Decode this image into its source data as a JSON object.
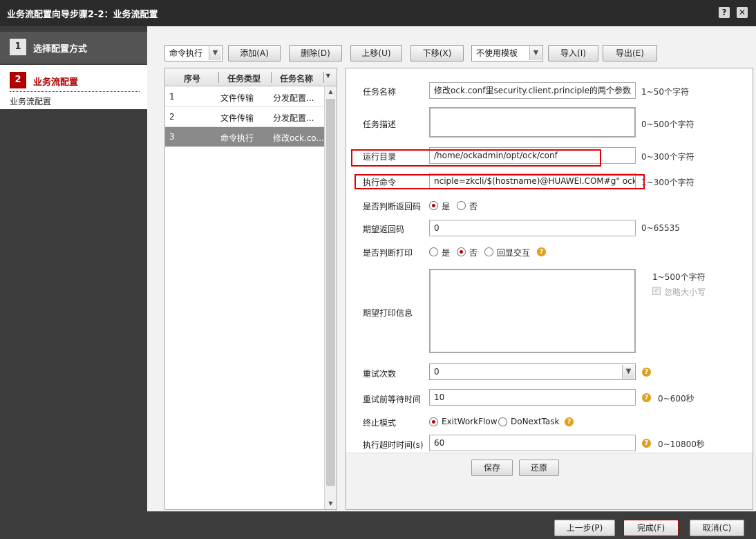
{
  "window": {
    "title": "业务流配置向导步骤2-2：业务流配置",
    "help_label": "?",
    "close_label": "✕"
  },
  "nav": {
    "step1": {
      "num": "1",
      "label": "选择配置方式"
    },
    "step2": {
      "num": "2",
      "label": "业务流配置",
      "sub": "业务流配置"
    }
  },
  "toolbar": {
    "type_select": "命令执行",
    "add": "添加(A)",
    "delete": "删除(D)",
    "move_up": "上移(U)",
    "move_down": "下移(X)",
    "template_select": "不使用模板",
    "import": "导入(I)",
    "export": "导出(E)"
  },
  "tasklist": {
    "headers": [
      "序号",
      "任务类型",
      "任务名称"
    ],
    "rows": [
      {
        "no": "1",
        "type": "文件传输",
        "name": "分发配置..."
      },
      {
        "no": "2",
        "type": "文件传输",
        "name": "分发配置..."
      },
      {
        "no": "3",
        "type": "命令执行",
        "name": "修改ock.co..."
      }
    ],
    "selected_row": 3
  },
  "form": {
    "task_name": {
      "label": "任务名称",
      "value": "修改ock.conf里security.client.principle的两个参数",
      "hint": "1~50个字符"
    },
    "task_desc": {
      "label": "任务描述",
      "value": "",
      "hint": "0~500个字符"
    },
    "run_dir": {
      "label": "运行目录",
      "value": "/home/ockadmin/opt/ock/conf",
      "hint": "0~300个字符"
    },
    "exec_cmd": {
      "label": "执行命令",
      "value": "nciple=zkcli/$(hostname)@HUAWEI.COM#g\" ock.conf",
      "hint": "1~300个字符"
    },
    "check_return": {
      "label": "是否判断返回码",
      "yes": "是",
      "no": "否",
      "selected": "是"
    },
    "expected_return": {
      "label": "期望返回码",
      "value": "0",
      "hint": "0~65535"
    },
    "check_print": {
      "label": "是否判断打印",
      "yes": "是",
      "no": "否",
      "echo": "回显交互",
      "selected": "否"
    },
    "expected_print": {
      "label": "期望打印信息",
      "value": "",
      "hint": "1~500个字符",
      "ignore_case": "忽略大小写"
    },
    "retry_count": {
      "label": "重试次数",
      "value": "0"
    },
    "retry_wait": {
      "label": "重试前等待时间",
      "value": "10",
      "hint": "0~600秒"
    },
    "stop_mode": {
      "label": "终止模式",
      "opt1": "ExitWorkFlow",
      "opt2": "DoNextTask",
      "selected": "ExitWorkFlow"
    },
    "exec_timeout": {
      "label": "执行超时时间(s)",
      "value": "60",
      "hint": "0~10800秒"
    },
    "save": "保存",
    "restore": "还原"
  },
  "footer": {
    "prev": "上一步(P)",
    "finish": "完成(F)",
    "cancel": "取消(C)"
  },
  "colors": {
    "accent": "#b10000",
    "highlight_box": "#e00000"
  }
}
